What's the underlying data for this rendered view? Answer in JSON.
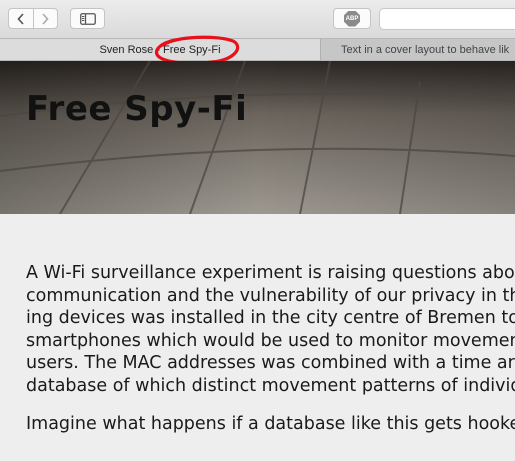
{
  "browser": {
    "toolbar": {
      "back_icon": "chevron-left",
      "forward_icon": "chevron-right",
      "sidebar_icon": "sidebar",
      "adblock_label": "ABP"
    },
    "tabs": [
      {
        "label": "Sven Rose - Free Spy-Fi",
        "active": true
      },
      {
        "label": "Text in a cover layout to behave lik",
        "active": false
      }
    ],
    "annotation_color": "#e8101a"
  },
  "page": {
    "title": "Free Spy-Fi",
    "paragraphs": [
      [
        "A Wi-Fi surveillance experiment is raising questions abou",
        "communication and the vulnerability of our privacy in the",
        "ing devices was installed in the city centre of Bremen to c",
        "smartphones which would be used to monitor movemen",
        "users. The MAC addresses was combined with a time ar",
        "database of which distinct movement patterns of individ"
      ],
      [
        "Imagine what happens if a database like this gets hooke"
      ]
    ]
  }
}
